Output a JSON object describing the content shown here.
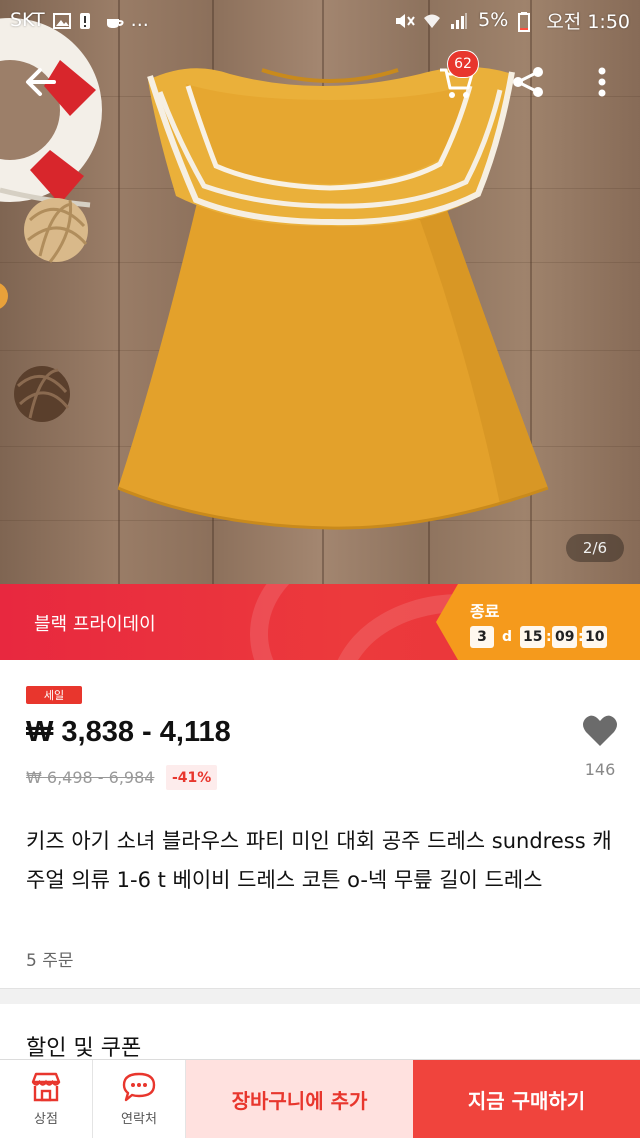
{
  "status_bar": {
    "carrier": "SKT",
    "more": "...",
    "battery": "5%",
    "time": "오전 1:50"
  },
  "top_nav": {
    "cart_count": "62",
    "image_counter": "2/6"
  },
  "promo": {
    "label": "블랙 프라이데이",
    "end_label": "종료",
    "days": "3",
    "day_unit": "d",
    "hours": "15",
    "minutes": "09",
    "seconds": "10",
    "sep": ":"
  },
  "product": {
    "sale_badge": "세일",
    "price_range": "₩ 3,838 - 4,118",
    "old_price": "₩ 6,498 - 6,984",
    "discount": "-41%",
    "wish_count": "146",
    "title": "키즈 아기 소녀 블라우스 파티 미인 대회 공주 드레스 sundress 캐주얼 의류 1-6 t 베이비 드레스 코튼 o-넥 무릎 길이 드레스",
    "orders": "5 주문"
  },
  "sections": {
    "coupon_heading": "할인 및 쿠폰"
  },
  "bottom_bar": {
    "store_label": "상점",
    "contact_label": "연락처",
    "add_to_cart": "장바구니에 추가",
    "buy_now": "지금 구매하기"
  },
  "colors": {
    "accent_red": "#e8362d",
    "timer_orange": "#f59a1c",
    "dress_mustard": "#e5a52e"
  },
  "icons": [
    "back-arrow-icon",
    "cart-icon",
    "share-icon",
    "more-vertical-icon",
    "heart-icon",
    "store-icon",
    "chat-icon"
  ]
}
